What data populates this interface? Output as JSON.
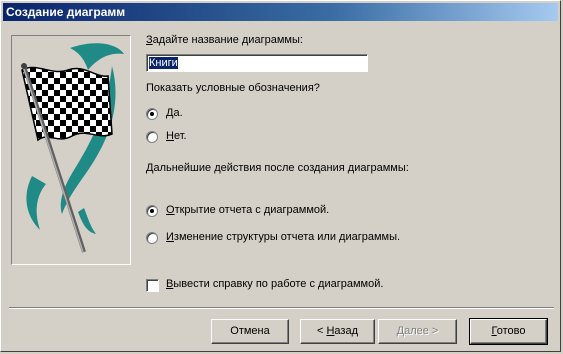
{
  "window": {
    "title": "Создание диаграмм"
  },
  "chart_name": {
    "label_first": "З",
    "label_rest": "адайте название диаграммы:",
    "value": "Книги"
  },
  "legend": {
    "label": "Показать условные обозначения?",
    "yes_first": "Д",
    "yes_rest": "а.",
    "yes_checked": true,
    "no_first": "Н",
    "no_rest": "ет.",
    "no_checked": false
  },
  "actions": {
    "label": "Дальнейшие действия после создания диаграммы:",
    "open_first": "О",
    "open_rest": "ткрытие отчета с диаграммой.",
    "open_checked": true,
    "modify_first": "И",
    "modify_rest": "зменение структуры отчета или диаграммы.",
    "modify_checked": false
  },
  "help": {
    "label_first": "В",
    "label_rest": "ывести справку по работе с диаграммой.",
    "checked": false
  },
  "buttons": {
    "cancel": "Отмена",
    "back_prefix": "< ",
    "back_u": "Н",
    "back_rest": "азад",
    "next_u": "Д",
    "next_rest": "алее >",
    "finish_u": "Г",
    "finish_rest": "отово"
  }
}
